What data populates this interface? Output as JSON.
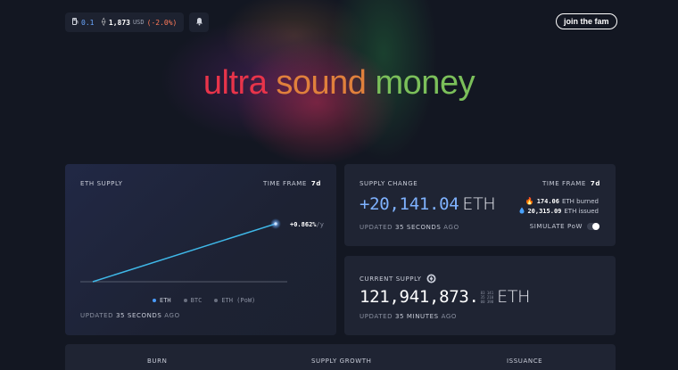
{
  "topbar": {
    "gas_icon": "fuel-pump-icon",
    "gas_value": "0.1",
    "eth_icon": "ethereum-icon",
    "eth_price": "1,873",
    "currency": "USD",
    "price_change": "(-2.0%)",
    "bell_icon": "bell-icon"
  },
  "header": {
    "cta_label": "join the fam"
  },
  "hero": {
    "words": [
      "ultra",
      "sound",
      "money"
    ],
    "colors": [
      "#e8344a",
      "#e0803c",
      "#7bbf5a"
    ]
  },
  "eth_supply": {
    "label": "ETH SUPPLY",
    "time_frame_label": "TIME FRAME",
    "time_frame_value": "7d",
    "chart_annotation": "+0.862%",
    "chart_annotation_unit": "/y",
    "legend": [
      {
        "label": "ETH",
        "color": "#4a9cff"
      },
      {
        "label": "BTC",
        "color": "#6a7080"
      },
      {
        "label": "ETH (PoW)",
        "color": "#6a7080"
      }
    ],
    "updated_prefix": "UPDATED",
    "updated_value": "35 SECONDS",
    "updated_suffix": "AGO"
  },
  "supply_change": {
    "label": "SUPPLY CHANGE",
    "time_frame_label": "TIME FRAME",
    "time_frame_value": "7d",
    "value": "+20,141.04",
    "unit": "ETH",
    "burned_icon": "fire-icon",
    "burned_value": "174.06",
    "burned_label": "ETH burned",
    "issued_icon": "droplet-icon",
    "issued_value": "20,315.09",
    "issued_label": "ETH issued",
    "updated_prefix": "UPDATED",
    "updated_value": "35 SECONDS",
    "updated_suffix": "AGO",
    "simulate_label": "SIMULATE PoW"
  },
  "current_supply": {
    "label": "CURRENT SUPPLY",
    "value": "121,941,873.",
    "decimals": [
      "83 141",
      "35 210",
      "00 398"
    ],
    "unit": "ETH",
    "updated_prefix": "UPDATED",
    "updated_value": "35 MINUTES",
    "updated_suffix": "AGO"
  },
  "bottom_tabs": [
    "BURN",
    "SUPPLY GROWTH",
    "ISSUANCE"
  ]
}
